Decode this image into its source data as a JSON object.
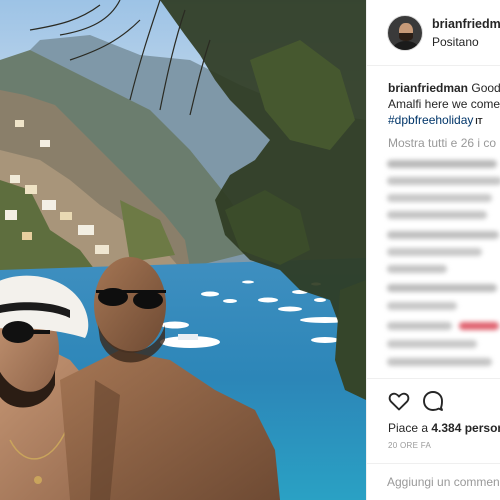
{
  "post": {
    "username": "brianfriedman",
    "location": "Positano",
    "caption": {
      "username": "brianfriedman",
      "line1": "Good",
      "line2": "Amalfi here we come",
      "hashtag": "#dpbfreeholiday",
      "badge": "IT"
    },
    "view_all_comments": "Mostra tutti e 26 i co",
    "likes_prefix": "Piace a ",
    "likes_count": "4.384",
    "likes_suffix": " person",
    "date": "20 ORE FA",
    "comment_placeholder": "Aggiungi un commen"
  },
  "icons": {
    "like": "heart-outline-icon",
    "comment": "speech-bubble-icon"
  },
  "colors": {
    "hashtag_link": "#003569",
    "muted_text": "#999999",
    "divider": "#efefef",
    "blurred_highlight": "#e0626f"
  }
}
